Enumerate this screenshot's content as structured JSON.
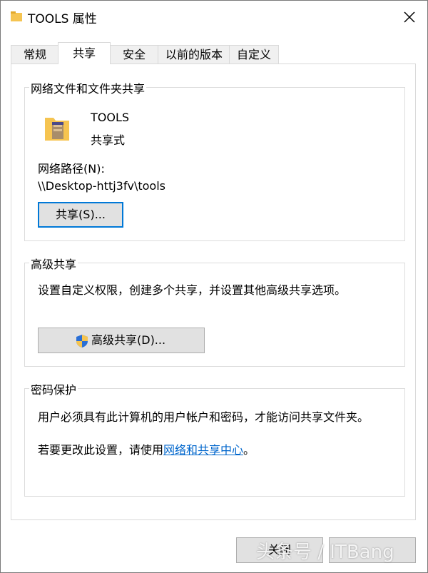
{
  "window": {
    "title": "TOOLS 属性",
    "close_label": "×"
  },
  "tabs": [
    {
      "label": "常规",
      "active": false
    },
    {
      "label": "共享",
      "active": true
    },
    {
      "label": "安全",
      "active": false
    },
    {
      "label": "以前的版本",
      "active": false
    },
    {
      "label": "自定义",
      "active": false
    }
  ],
  "network_sharing": {
    "group_label": "网络文件和文件夹共享",
    "folder_name": "TOOLS",
    "folder_status": "共享式",
    "network_path_label": "网络路径(N):",
    "network_path": "\\\\Desktop-httj3fv\\tools",
    "share_button": "共享(S)..."
  },
  "advanced_sharing": {
    "group_label": "高级共享",
    "description": "设置自定义权限，创建多个共享，并设置其他高级共享选项。",
    "button": "高级共享(D)..."
  },
  "password_protection": {
    "group_label": "密码保护",
    "text1": "用户必须具有此计算机的用户帐户和密码，才能访问共享文件夹。",
    "text2_prefix": "若要更改此设置，请使用",
    "text2_link": "网络和共享中心",
    "text2_suffix": "。"
  },
  "footer": {
    "close_button": "关闭",
    "watermark": "头条号 / ITBang"
  },
  "colors": {
    "link": "#0066cc",
    "focus_border": "#0078d7",
    "folder": "#f5c451"
  }
}
